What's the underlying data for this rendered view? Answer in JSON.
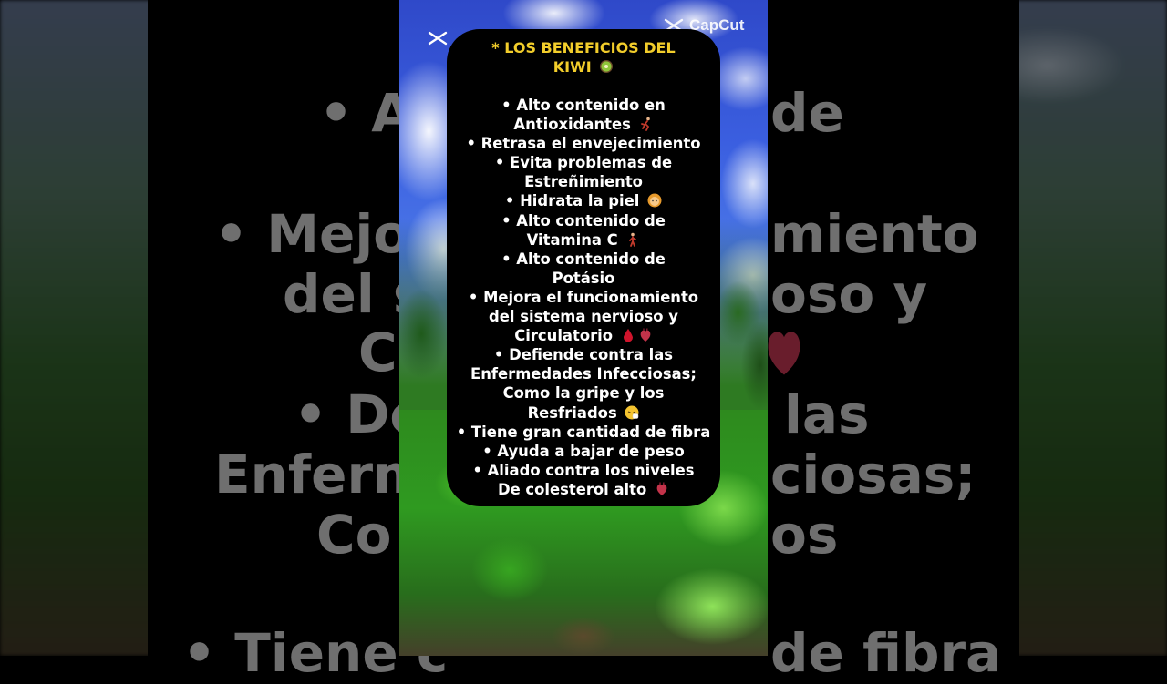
{
  "card": {
    "title_line1": "* LOS BENEFICIOS DEL",
    "title_line2": "KIWI",
    "items": [
      {
        "lines": [
          "• Alto contenido en",
          "Antioxidantes"
        ],
        "icon": "runner-icon"
      },
      {
        "lines": [
          "• Retrasa el envejecimiento"
        ]
      },
      {
        "lines": [
          "• Evita problemas de",
          "Estreñimiento"
        ]
      },
      {
        "lines": [
          "• Hidrata la piel"
        ],
        "icon": "woman-face-icon"
      },
      {
        "lines": [
          "• Alto contenido de",
          "Vitamina C"
        ],
        "icon": "walker-icon"
      },
      {
        "lines": [
          "• Alto contenido de",
          "Potásio"
        ]
      },
      {
        "lines": [
          "• Mejora el funcionamiento",
          "del sistema nervioso y",
          "Circulatorio"
        ],
        "icon": "blood-drop-heart-icons"
      },
      {
        "lines": [
          "• Defiende contra las",
          "Enfermedades Infecciosas;",
          "Como la gripe y los",
          "Resfriados"
        ],
        "icon": "sneezing-face-icon"
      },
      {
        "lines": [
          "• Tiene gran cantidad de fibra"
        ]
      },
      {
        "lines": [
          "• Ayuda a bajar de peso"
        ]
      },
      {
        "lines": [
          "• Aliado contra los niveles",
          "De colesterol alto"
        ],
        "icon": "anatomical-heart-icon"
      }
    ]
  },
  "overlay": {
    "brand": "CapCut"
  },
  "background_text": {
    "left": [
      "• A",
      "• Mejor",
      "del si",
      "C",
      "• De",
      "Enferm",
      "Co",
      "• Tiene c"
    ],
    "right": [
      "de",
      "miento",
      "oso y",
      "las",
      "ciosas;",
      "os",
      "de fibra"
    ]
  },
  "colors": {
    "title": "#f2cd2b",
    "card": "#000000",
    "text": "#ffffff"
  }
}
